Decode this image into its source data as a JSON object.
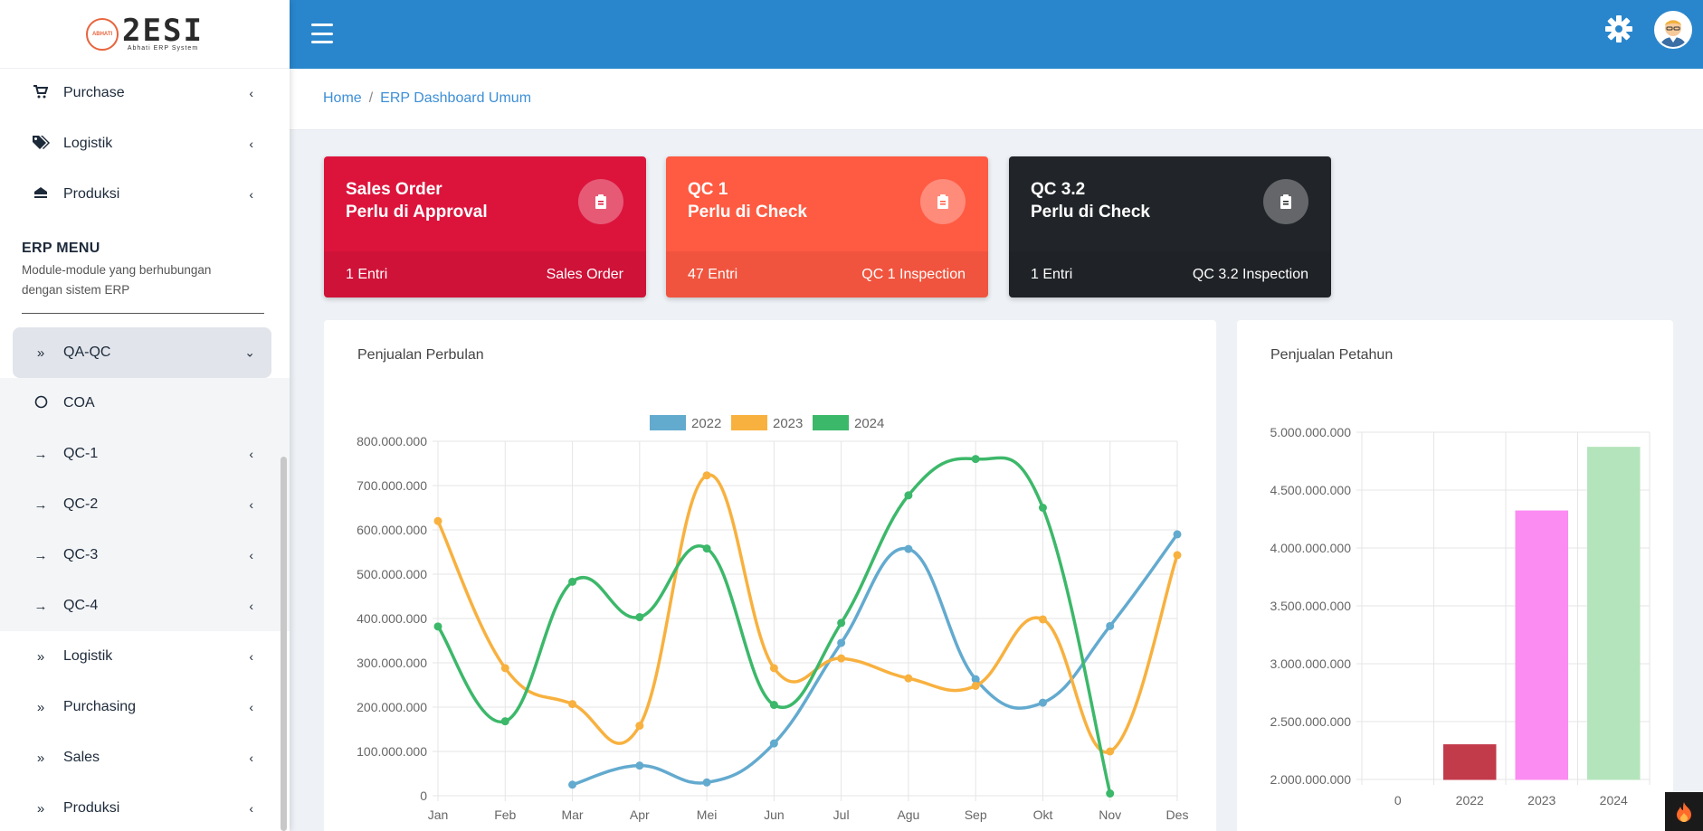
{
  "brand": {
    "mark": "ABHATI",
    "name": "2ESI",
    "subtitle": "Abhati ERP System"
  },
  "sidebar": {
    "top_items": [
      {
        "label": "Purchase",
        "icon": "cart-icon"
      },
      {
        "label": "Logistik",
        "icon": "tags-icon"
      },
      {
        "label": "Produksi",
        "icon": "bolt-icon"
      }
    ],
    "menu_heading": "ERP MENU",
    "menu_desc": "Module-module yang berhubungan dengan sistem ERP",
    "active_item": {
      "label": "QA-QC",
      "icon": "double-chevron-right-icon"
    },
    "sub_items": [
      {
        "label": "COA",
        "icon": "circle-icon"
      },
      {
        "label": "QC-1",
        "icon": "arrow-right-icon"
      },
      {
        "label": "QC-2",
        "icon": "arrow-right-icon"
      },
      {
        "label": "QC-3",
        "icon": "arrow-right-icon"
      },
      {
        "label": "QC-4",
        "icon": "arrow-right-icon"
      }
    ],
    "bottom_items": [
      {
        "label": "Logistik",
        "icon": "double-chevron-right-icon"
      },
      {
        "label": "Purchasing",
        "icon": "double-chevron-right-icon"
      },
      {
        "label": "Sales",
        "icon": "double-chevron-right-icon"
      },
      {
        "label": "Produksi",
        "icon": "double-chevron-right-icon"
      }
    ]
  },
  "topbar": {
    "color": "#2986cc"
  },
  "breadcrumb": {
    "home": "Home",
    "current": "ERP Dashboard Umum"
  },
  "cards": [
    {
      "title1": "Sales Order",
      "title2": "Perlu di Approval",
      "count": "1 Entri",
      "link": "Sales Order",
      "color": "#dc143c"
    },
    {
      "title1": "QC 1",
      "title2": "Perlu di Check",
      "count": "47 Entri",
      "link": "QC 1 Inspection",
      "color": "#ff5a42"
    },
    {
      "title1": "QC 3.2",
      "title2": "Perlu di Check",
      "count": "1 Entri",
      "link": "QC 3.2 Inspection",
      "color": "#212529"
    }
  ],
  "panels": {
    "monthly_title": "Penjualan Perbulan",
    "yearly_title": "Penjualan Petahun"
  },
  "chart_data": [
    {
      "type": "line",
      "title": "Penjualan Perbulan",
      "categories": [
        "Jan",
        "Feb",
        "Mar",
        "Apr",
        "Mei",
        "Jun",
        "Jul",
        "Agu",
        "Sep",
        "Okt",
        "Nov",
        "Des"
      ],
      "ylim": [
        0,
        800000000
      ],
      "y_ticks": [
        "0",
        "100.000.000",
        "200.000.000",
        "300.000.000",
        "400.000.000",
        "500.000.000",
        "600.000.000",
        "700.000.000",
        "800.000.000"
      ],
      "legend_position": "top",
      "grid": true,
      "series": [
        {
          "name": "2022",
          "color": "#63aacf",
          "values": [
            null,
            null,
            25000000,
            68000000,
            30000000,
            118000000,
            345000000,
            557000000,
            263000000,
            210000000,
            383000000,
            590000000
          ]
        },
        {
          "name": "2023",
          "color": "#f8b13f",
          "values": [
            620000000,
            288000000,
            207000000,
            158000000,
            723000000,
            288000000,
            310000000,
            265000000,
            248000000,
            398000000,
            100000000,
            543000000
          ]
        },
        {
          "name": "2024",
          "color": "#3cb86a",
          "values": [
            382000000,
            168000000,
            483000000,
            403000000,
            558000000,
            205000000,
            390000000,
            678000000,
            760000000,
            650000000,
            5000000,
            null
          ]
        }
      ]
    },
    {
      "type": "bar",
      "title": "Penjualan Petahun",
      "categories": [
        "0",
        "2022",
        "2023",
        "2024"
      ],
      "values": [
        null,
        2300000000,
        4320000000,
        4870000000
      ],
      "colors": [
        "#c23b4b",
        "#c23b4b",
        "#fb8cf2",
        "#b4e4bb"
      ],
      "ylim": [
        2000000000,
        5000000000
      ],
      "y_ticks": [
        "2.000.000.000",
        "2.500.000.000",
        "3.000.000.000",
        "3.500.000.000",
        "4.000.000.000",
        "4.500.000.000",
        "5.000.000.000"
      ],
      "grid": true
    }
  ]
}
